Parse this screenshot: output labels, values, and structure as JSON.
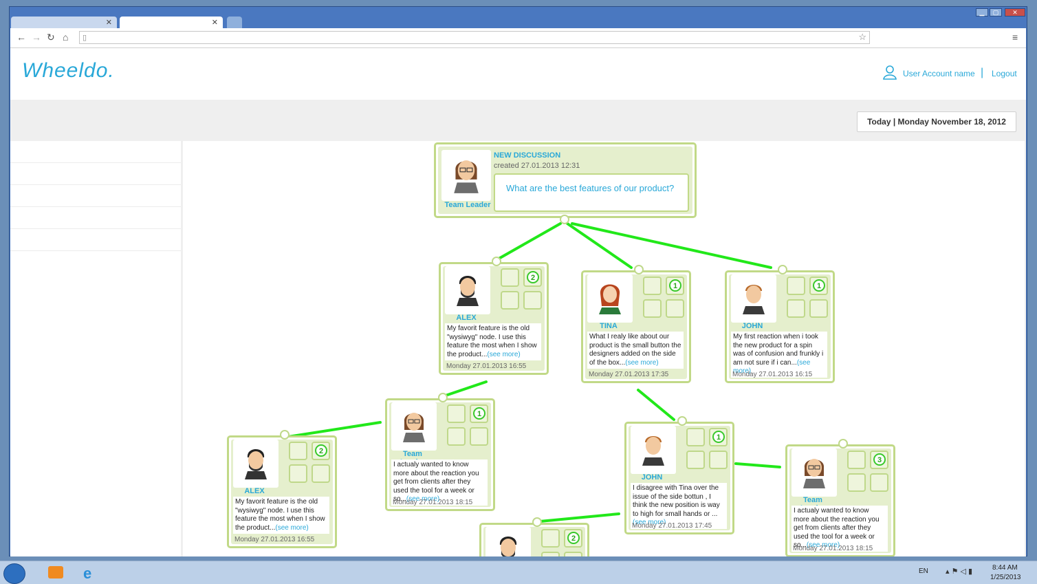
{
  "browser": {
    "tabs": [
      {
        "label": ""
      },
      {
        "label": ""
      }
    ],
    "address": ""
  },
  "header": {
    "logo": "Wheeldo.",
    "user_link": "User Account name",
    "separator": "|",
    "logout": "Logout"
  },
  "date_label": "Today | Monday November 18, 2012",
  "root": {
    "title": "NEW DISCUSSION",
    "created": "created 27.01.2013 12:31",
    "question": "What are the best features of our product?",
    "author": "Team Leader"
  },
  "see_more": "(see more)",
  "nodes": [
    {
      "name": "ALEX",
      "count": "2",
      "text": "My favorit feature is the old \"wysiwyg\" node. I use this feature the most when I show the product...",
      "date": "Monday 27.01.2013 16:55"
    },
    {
      "name": "TINA",
      "count": "1",
      "text": "What I realy like about our product is the small button the designers added on the side of the box...",
      "date": "Monday 27.01.2013 17:35"
    },
    {
      "name": "JOHN",
      "count": "1",
      "text": "My first reaction when i took the new product for a spin was of confusion and frunkly i am not sure if i can...",
      "date": "Monday 27.01.2013 16:15"
    },
    {
      "name": "Team Leader",
      "count": "1",
      "text": "I actualy wanted to know more about the reaction you get from clients after they used the tool for a week or so...",
      "date": "Monday 27.01.2013 18:15"
    },
    {
      "name": "JOHN",
      "count": "1",
      "text": "I disagree with Tina over the issue of the side bottun , I think the new position is way to high for small hands or ...",
      "date": "Monday 27.01.2013 17:45"
    },
    {
      "name": "ALEX",
      "count": "2",
      "text": "My favorit feature is the old \"wysiwyg\" node. I use this feature the most when I show the product...",
      "date": "Monday 27.01.2013 16:55"
    },
    {
      "name": "Team Leader",
      "count": "3",
      "text": "I actualy wanted to know more about the reaction you get from clients after they used the tool for a week or so...",
      "date": "Monday 27.01.2013 18:15"
    },
    {
      "name": "",
      "count": "2",
      "text": "",
      "date": ""
    }
  ],
  "taskbar": {
    "lang": "EN",
    "time": "8:44 AM",
    "date": "1/25/2013"
  },
  "colors": {
    "accent": "#29a8d8",
    "connector": "#22e81a",
    "node_border": "#c1d987"
  }
}
